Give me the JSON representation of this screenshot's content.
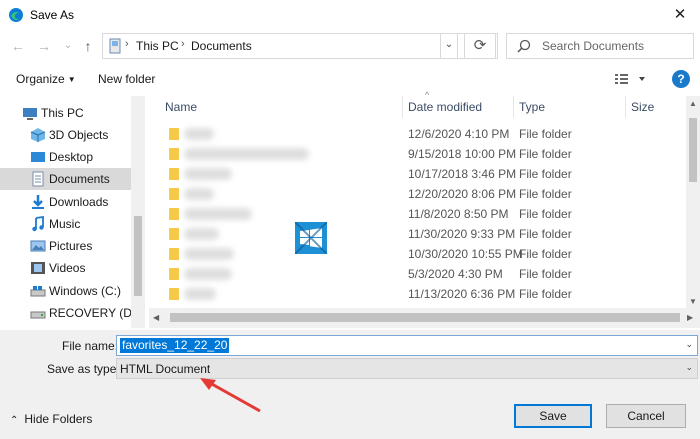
{
  "window": {
    "title": "Save As",
    "close_glyph": "✕"
  },
  "nav": {
    "back_glyph": "←",
    "forward_glyph": "→",
    "recent_glyph": "⌄",
    "up_glyph": "↑",
    "breadcrumb": [
      "This PC",
      "Documents"
    ],
    "sep_glyph": "›",
    "refresh_glyph": "⟳",
    "search_placeholder": "Search Documents"
  },
  "toolbar": {
    "organize_label": "Organize",
    "new_folder_label": "New folder",
    "help_glyph": "?"
  },
  "sidebar": {
    "items": [
      {
        "label": "This PC",
        "icon": "pc-icon"
      },
      {
        "label": "3D Objects",
        "icon": "3d-objects-icon"
      },
      {
        "label": "Desktop",
        "icon": "desktop-icon"
      },
      {
        "label": "Documents",
        "icon": "documents-icon"
      },
      {
        "label": "Downloads",
        "icon": "downloads-icon"
      },
      {
        "label": "Music",
        "icon": "music-icon"
      },
      {
        "label": "Pictures",
        "icon": "pictures-icon"
      },
      {
        "label": "Videos",
        "icon": "videos-icon"
      },
      {
        "label": "Windows (C:)",
        "icon": "drive-c-icon"
      },
      {
        "label": "RECOVERY (D:)",
        "icon": "drive-d-icon"
      }
    ]
  },
  "list": {
    "columns": [
      "Name",
      "Date modified",
      "Type",
      "Size"
    ],
    "rows": [
      {
        "date": "12/6/2020 4:10 PM",
        "type": "File folder"
      },
      {
        "date": "9/15/2018 10:00 PM",
        "type": "File folder"
      },
      {
        "date": "10/17/2018 3:46 PM",
        "type": "File folder"
      },
      {
        "date": "12/20/2020 8:06 PM",
        "type": "File folder"
      },
      {
        "date": "11/8/2020 8:50 PM",
        "type": "File folder"
      },
      {
        "date": "11/30/2020 9:33 PM",
        "type": "File folder"
      },
      {
        "date": "10/30/2020 10:55 PM",
        "type": "File folder"
      },
      {
        "date": "5/3/2020 4:30 PM",
        "type": "File folder"
      },
      {
        "date": "11/13/2020 6:36 PM",
        "type": "File folder"
      }
    ]
  },
  "form": {
    "filename_label": "File name:",
    "filename_value": "favorites_12_22_20",
    "savetype_label": "Save as type:",
    "savetype_value": "HTML Document",
    "dropdown_glyph": "⌄"
  },
  "footer": {
    "hide_folders_label": "Hide Folders",
    "hide_glyph": "⌃",
    "save_label": "Save",
    "cancel_label": "Cancel"
  },
  "colors": {
    "accent": "#0078d7",
    "folder": "#f7c948",
    "annotation": "#e53935"
  }
}
